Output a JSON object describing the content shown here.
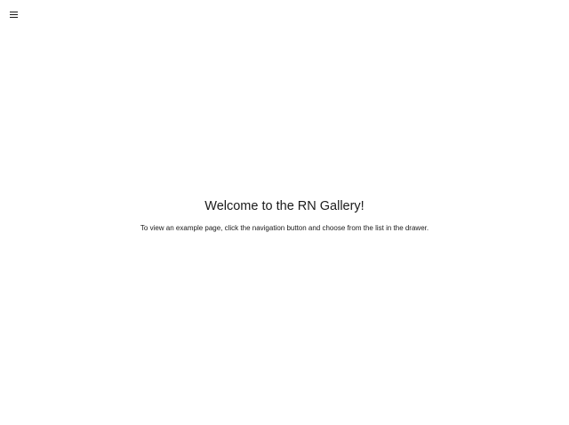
{
  "header": {
    "nav_button_icon": "hamburger-menu-icon"
  },
  "main": {
    "title": "Welcome to the RN Gallery!",
    "subtitle": "To view an example page, click the navigation button and choose from the list in the drawer."
  }
}
